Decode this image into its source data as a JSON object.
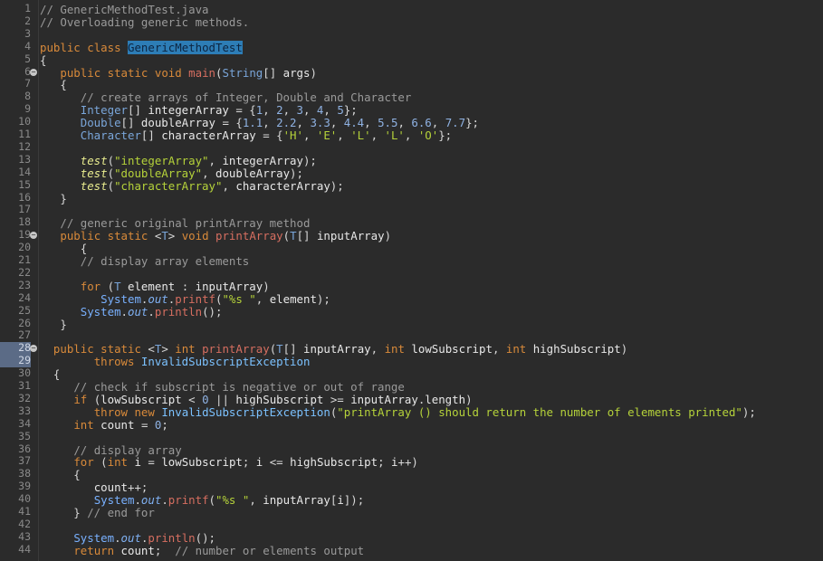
{
  "code_lines": [
    {
      "n": "1",
      "t": "// GenericMethodTest.java"
    },
    {
      "n": "2",
      "t": "// Overloading generic methods."
    },
    {
      "n": "3",
      "t": ""
    },
    {
      "n": "4",
      "t": "public class GenericMethodTest"
    },
    {
      "n": "5",
      "t": "{"
    },
    {
      "n": "6",
      "t": "   public static void main(String[] args)"
    },
    {
      "n": "7",
      "t": "   {"
    },
    {
      "n": "8",
      "t": "      // create arrays of Integer, Double and Character"
    },
    {
      "n": "9",
      "t": "      Integer[] integerArray = {1, 2, 3, 4, 5};"
    },
    {
      "n": "10",
      "t": "      Double[] doubleArray = {1.1, 2.2, 3.3, 4.4, 5.5, 6.6, 7.7};"
    },
    {
      "n": "11",
      "t": "      Character[] characterArray = {'H', 'E', 'L', 'L', 'O'};"
    },
    {
      "n": "12",
      "t": ""
    },
    {
      "n": "13",
      "t": "      test(\"integerArray\", integerArray);"
    },
    {
      "n": "14",
      "t": "      test(\"doubleArray\", doubleArray);"
    },
    {
      "n": "15",
      "t": "      test(\"characterArray\", characterArray);"
    },
    {
      "n": "16",
      "t": "   }"
    },
    {
      "n": "17",
      "t": ""
    },
    {
      "n": "18",
      "t": "   // generic original printArray method"
    },
    {
      "n": "19",
      "t": "   public static <T> void printArray(T[] inputArray)"
    },
    {
      "n": "20",
      "t": "      {"
    },
    {
      "n": "21",
      "t": "      // display array elements"
    },
    {
      "n": "22",
      "t": ""
    },
    {
      "n": "23",
      "t": "      for (T element : inputArray)"
    },
    {
      "n": "24",
      "t": "         System.out.printf(\"%s \", element);"
    },
    {
      "n": "25",
      "t": "      System.out.println();"
    },
    {
      "n": "26",
      "t": "   }"
    },
    {
      "n": "27",
      "t": ""
    },
    {
      "n": "28",
      "t": "  public static <T> int printArray(T[] inputArray, int lowSubscript, int highSubscript)"
    },
    {
      "n": "29",
      "t": "        throws InvalidSubscriptException"
    },
    {
      "n": "30",
      "t": "  {"
    },
    {
      "n": "31",
      "t": "     // check if subscript is negative or out of range"
    },
    {
      "n": "32",
      "t": "     if (lowSubscript < 0 || highSubscript >= inputArray.length)"
    },
    {
      "n": "33",
      "t": "        throw new InvalidSubscriptException(\"printArray () should return the number of elements printed\");"
    },
    {
      "n": "34",
      "t": "     int count = 0;"
    },
    {
      "n": "35",
      "t": ""
    },
    {
      "n": "36",
      "t": "     // display array"
    },
    {
      "n": "37",
      "t": "     for (int i = lowSubscript; i <= highSubscript; i++)"
    },
    {
      "n": "38",
      "t": "     {"
    },
    {
      "n": "39",
      "t": "        count++;"
    },
    {
      "n": "40",
      "t": "        System.out.printf(\"%s \", inputArray[i]);"
    },
    {
      "n": "41",
      "t": "     } // end for"
    },
    {
      "n": "42",
      "t": ""
    },
    {
      "n": "43",
      "t": "     System.out.println();"
    },
    {
      "n": "44",
      "t": "     return count;  // number or elements output"
    }
  ],
  "fold_markers": [
    "6",
    "19",
    "28"
  ],
  "selected_lines": [
    "28",
    "29"
  ],
  "highlighted_identifier": "GenericMethodTest",
  "colors": {
    "background": "#2b2b2b",
    "keyword": "#d98a3a",
    "type": "#7aa6da",
    "string": "#b5d23a",
    "comment": "#9a9a9a",
    "selection": "#2d7db6"
  }
}
